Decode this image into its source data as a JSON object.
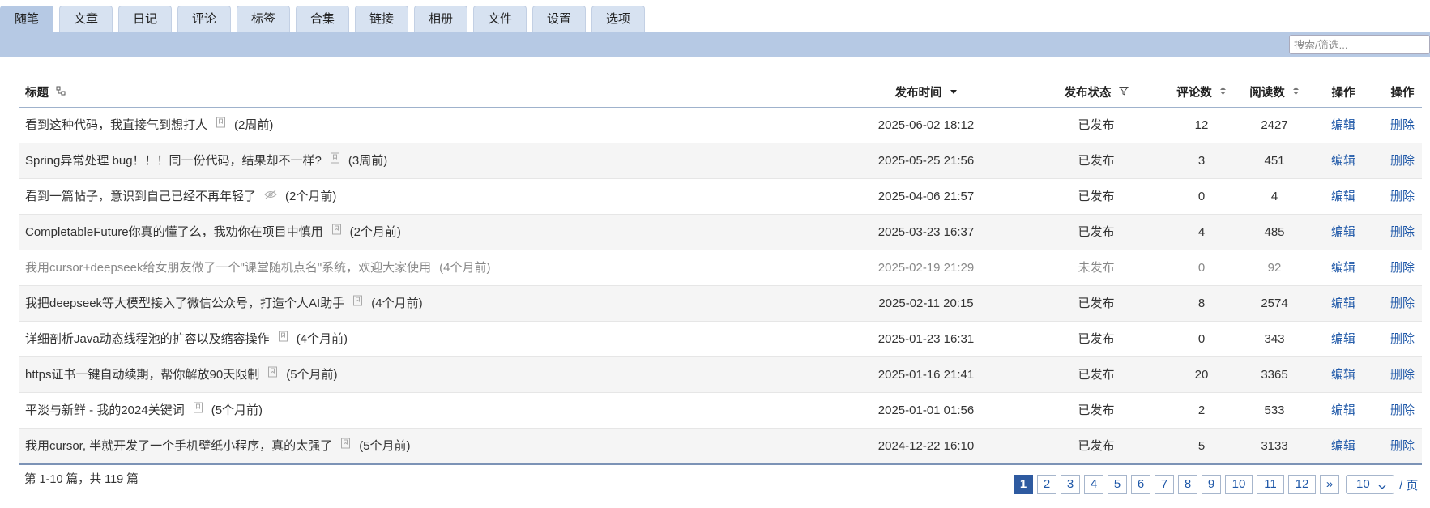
{
  "tabs": [
    "随笔",
    "文章",
    "日记",
    "评论",
    "标签",
    "合集",
    "链接",
    "相册",
    "文件",
    "设置",
    "选项"
  ],
  "search": {
    "placeholder": "搜索/筛选..."
  },
  "table": {
    "headers": {
      "title": "标题",
      "time": "发布时间",
      "status": "发布状态",
      "comments": "评论数",
      "reads": "阅读数",
      "edit": "操作",
      "delete": "操作"
    },
    "rows": [
      {
        "title": "看到这种代码，我直接气到想打人",
        "icon": "bookmark-icon",
        "ago": "(2周前)",
        "time": "2025-06-02 18:12",
        "status": "已发布",
        "comments": "12",
        "reads": "2427",
        "edit": "编辑",
        "delete": "删除",
        "published": true
      },
      {
        "title": "Spring异常处理 bug！！！同一份代码，结果却不一样?",
        "icon": "bookmark-icon",
        "ago": "(3周前)",
        "time": "2025-05-25 21:56",
        "status": "已发布",
        "comments": "3",
        "reads": "451",
        "edit": "编辑",
        "delete": "删除",
        "published": true
      },
      {
        "title": "看到一篇帖子，意识到自己已经不再年轻了",
        "icon": "eye-off-icon",
        "ago": "(2个月前)",
        "time": "2025-04-06 21:57",
        "status": "已发布",
        "comments": "0",
        "reads": "4",
        "edit": "编辑",
        "delete": "删除",
        "published": true
      },
      {
        "title": "CompletableFuture你真的懂了么，我劝你在项目中慎用",
        "icon": "bookmark-icon",
        "ago": "(2个月前)",
        "time": "2025-03-23 16:37",
        "status": "已发布",
        "comments": "4",
        "reads": "485",
        "edit": "编辑",
        "delete": "删除",
        "published": true
      },
      {
        "title": "我用cursor+deepseek给女朋友做了一个\"课堂随机点名\"系统，欢迎大家使用",
        "icon": "",
        "ago": "(4个月前)",
        "time": "2025-02-19 21:29",
        "status": "未发布",
        "comments": "0",
        "reads": "92",
        "edit": "编辑",
        "delete": "删除",
        "published": false
      },
      {
        "title": "我把deepseek等大模型接入了微信公众号，打造个人AI助手",
        "icon": "bookmark-icon",
        "ago": "(4个月前)",
        "time": "2025-02-11 20:15",
        "status": "已发布",
        "comments": "8",
        "reads": "2574",
        "edit": "编辑",
        "delete": "删除",
        "published": true
      },
      {
        "title": "详细剖析Java动态线程池的扩容以及缩容操作",
        "icon": "bookmark-icon",
        "ago": "(4个月前)",
        "time": "2025-01-23 16:31",
        "status": "已发布",
        "comments": "0",
        "reads": "343",
        "edit": "编辑",
        "delete": "删除",
        "published": true
      },
      {
        "title": "https证书一键自动续期，帮你解放90天限制",
        "icon": "bookmark-icon",
        "ago": "(5个月前)",
        "time": "2025-01-16 21:41",
        "status": "已发布",
        "comments": "20",
        "reads": "3365",
        "edit": "编辑",
        "delete": "删除",
        "published": true
      },
      {
        "title": "平淡与新鲜 - 我的2024关键词",
        "icon": "bookmark-icon",
        "ago": "(5个月前)",
        "time": "2025-01-01 01:56",
        "status": "已发布",
        "comments": "2",
        "reads": "533",
        "edit": "编辑",
        "delete": "删除",
        "published": true
      },
      {
        "title": "我用cursor, 半就开发了一个手机壁纸小程序，真的太强了",
        "icon": "bookmark-icon",
        "ago": "(5个月前)",
        "time": "2024-12-22 16:10",
        "status": "已发布",
        "comments": "5",
        "reads": "3133",
        "edit": "编辑",
        "delete": "删除",
        "published": true
      }
    ]
  },
  "footer": {
    "summary": "第 1-10 篇，共 119 篇",
    "pages": [
      "1",
      "2",
      "3",
      "4",
      "5",
      "6",
      "7",
      "8",
      "9",
      "10",
      "11",
      "12"
    ],
    "current_page": "1",
    "next": "»",
    "page_size": "10",
    "per_page_label": "/ 页"
  },
  "colors": {
    "tabbar": "#b6c9e4",
    "tab": "#d7e2f1",
    "link": "#1f58a8",
    "pager_active": "#2e5aa0"
  }
}
